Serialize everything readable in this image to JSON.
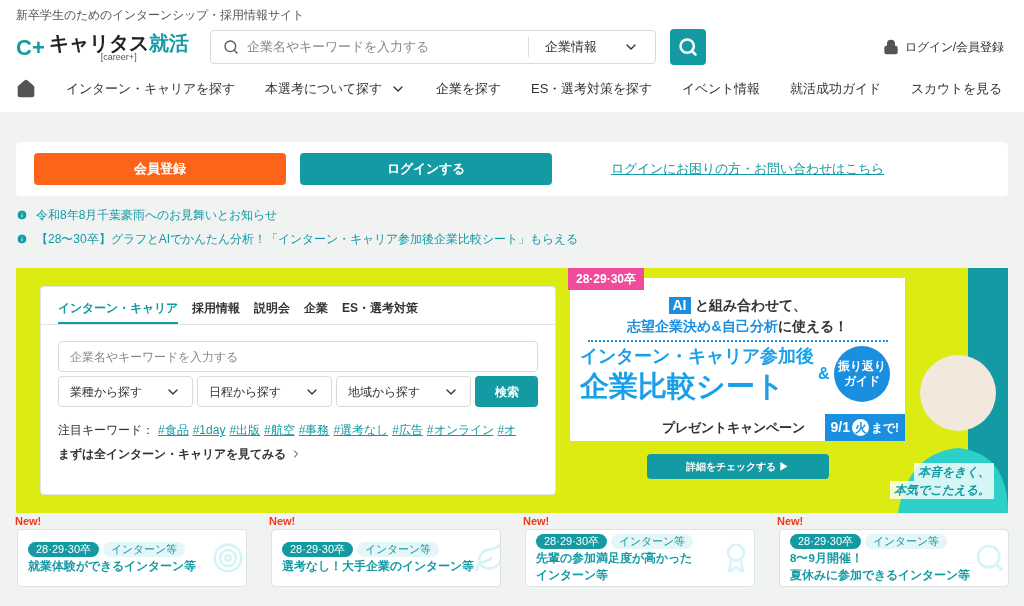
{
  "tagline": "新卒学生のためのインターンシップ・採用情報サイト",
  "logo": {
    "mark": "C+",
    "name": "キャリタス",
    "accent": "就活",
    "sub": "[career+]"
  },
  "search": {
    "placeholder": "企業名やキーワードを入力する",
    "category": "企業情報"
  },
  "account_link": "ログイン/会員登録",
  "nav": [
    {
      "label": "インターン・キャリアを探す",
      "has_menu": false
    },
    {
      "label": "本選考について探す",
      "has_menu": true
    },
    {
      "label": "企業を探す",
      "has_menu": false
    },
    {
      "label": "ES・選考対策を探す",
      "has_menu": false
    },
    {
      "label": "イベント情報",
      "has_menu": false
    },
    {
      "label": "就活成功ガイド",
      "has_menu": false
    },
    {
      "label": "スカウトを見る",
      "has_menu": false
    }
  ],
  "auth": {
    "register": "会員登録",
    "login": "ログインする",
    "help": "ログインにお困りの方・お問い合わせはこちら"
  },
  "notices": [
    "令和8年8月千葉豪雨へのお見舞いとお知らせ",
    "【28〜30卒】グラフとAIでかんたん分析！「インターン・キャリア参加後企業比較シート」もらえる"
  ],
  "search_panel": {
    "tabs": [
      {
        "label": "インターン・キャリア",
        "selected": true
      },
      {
        "label": "採用情報",
        "selected": false
      },
      {
        "label": "説明会",
        "selected": false
      },
      {
        "label": "企業",
        "selected": false
      },
      {
        "label": "ES・選考対策",
        "selected": false
      }
    ],
    "placeholder": "企業名やキーワードを入力する",
    "selects": [
      "業種から探す",
      "日程から探す",
      "地域から探す"
    ],
    "button": "検索",
    "keywords_label": "注目キーワード：",
    "keywords": [
      "#食品",
      "#1day",
      "#出版",
      "#航空",
      "#事務",
      "#選考なし",
      "#広告",
      "#オンライン",
      "#オ"
    ],
    "all_link": "まずは全インターン・キャリアを見てみる"
  },
  "promo": {
    "badge": "28·29·30卒",
    "ai": "AI",
    "line1": "と組み合わせて、",
    "line2_accent": "志望企業決め&自己分析",
    "line2": "に使える！",
    "title1": "インターン・キャリア参加後",
    "title2": "企業比較シート",
    "amp": "&",
    "guide": [
      "振り返り",
      "ガイド"
    ],
    "campaign": "プレゼントキャンペーン",
    "deadline": "9/1",
    "weekday": "火",
    "until": "まで!",
    "button": "詳細をチェックする ▶",
    "catch1": "本音をきく、",
    "catch2": "本気でこたえる。"
  },
  "cards": [
    {
      "new": "New!",
      "grad": "28·29·30卒",
      "tag": "インターン等",
      "title": [
        "就業体験ができるインターン等"
      ],
      "kind": "target"
    },
    {
      "new": "New!",
      "grad": "28·29·30卒",
      "tag": "インターン等",
      "title": [
        "選考なし！大手企業のインターン等"
      ],
      "kind": "leaf"
    },
    {
      "new": "New!",
      "grad": "28·29·30卒",
      "tag": "インターン等",
      "title": [
        "先輩の参加満足度が高かった",
        "インターン等"
      ],
      "kind": "award"
    },
    {
      "new": "New!",
      "grad": "28·29·30卒",
      "tag": "インターン等",
      "title": [
        "8〜9月開催！",
        "夏休みに参加できるインターン等"
      ],
      "kind": "search"
    }
  ]
}
